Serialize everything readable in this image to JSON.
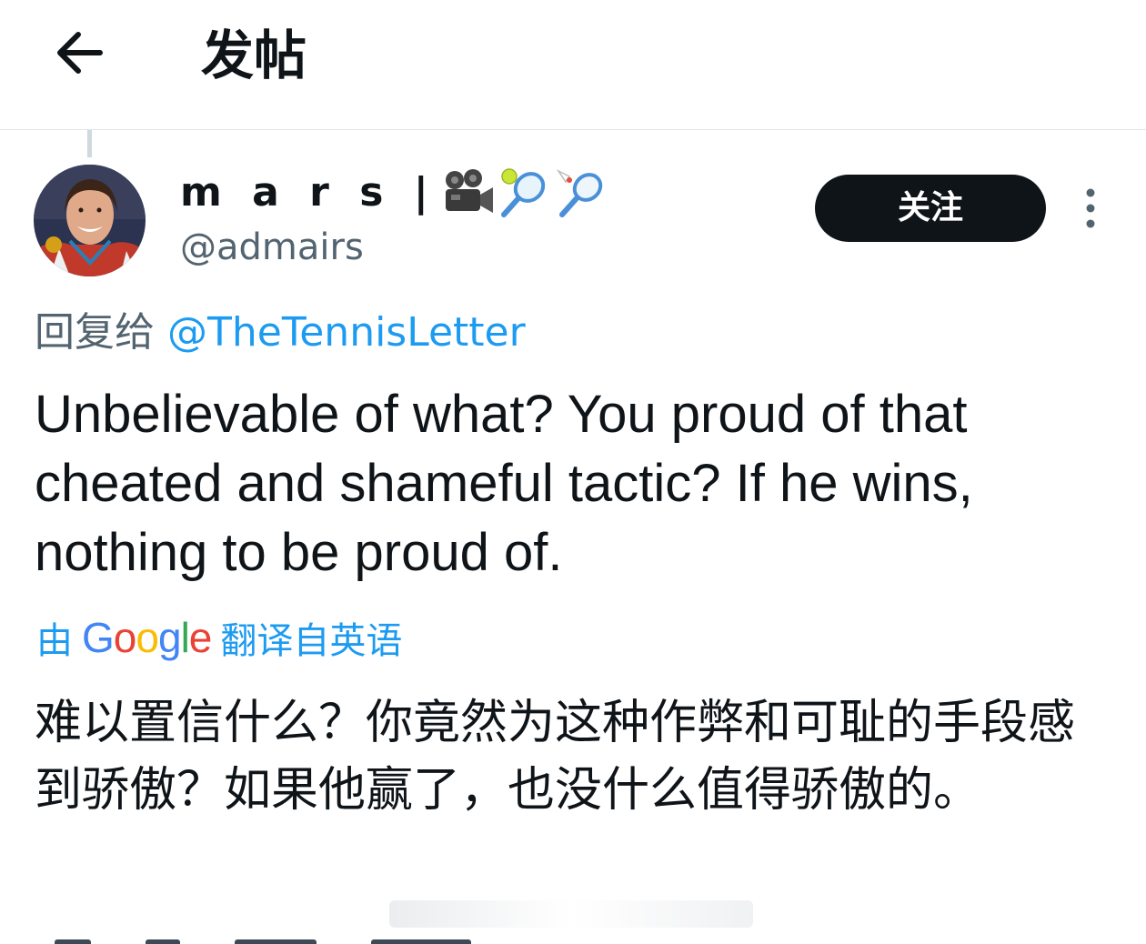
{
  "header": {
    "title": "发帖",
    "back_icon": "arrow-left-icon"
  },
  "author": {
    "display_name": "m a r s |",
    "name_emojis": [
      "movie-camera-icon",
      "tennis-racket-icon",
      "badminton-icon"
    ],
    "handle": "@admairs",
    "follow_label": "关注",
    "more_icon": "more-vertical-icon"
  },
  "reply": {
    "prefix": "回复给 ",
    "target": "@TheTennisLetter"
  },
  "tweet": {
    "text": "Unbelievable of what? You proud of that cheated and shameful tactic? If he wins, nothing to be proud of."
  },
  "translation": {
    "prefix": "由",
    "provider": "Google",
    "suffix": "翻译自英语",
    "text": "难以置信什么？你竟然为这种作弊和可耻的手段感到骄傲？如果他赢了，也没什么值得骄傲的。"
  },
  "colors": {
    "accent": "#1d9bf0",
    "text": "#0f1419",
    "secondary": "#536471",
    "google_blue": "#4285F4",
    "google_red": "#EA4335",
    "google_yellow": "#FBBC05",
    "google_green": "#34A853"
  }
}
